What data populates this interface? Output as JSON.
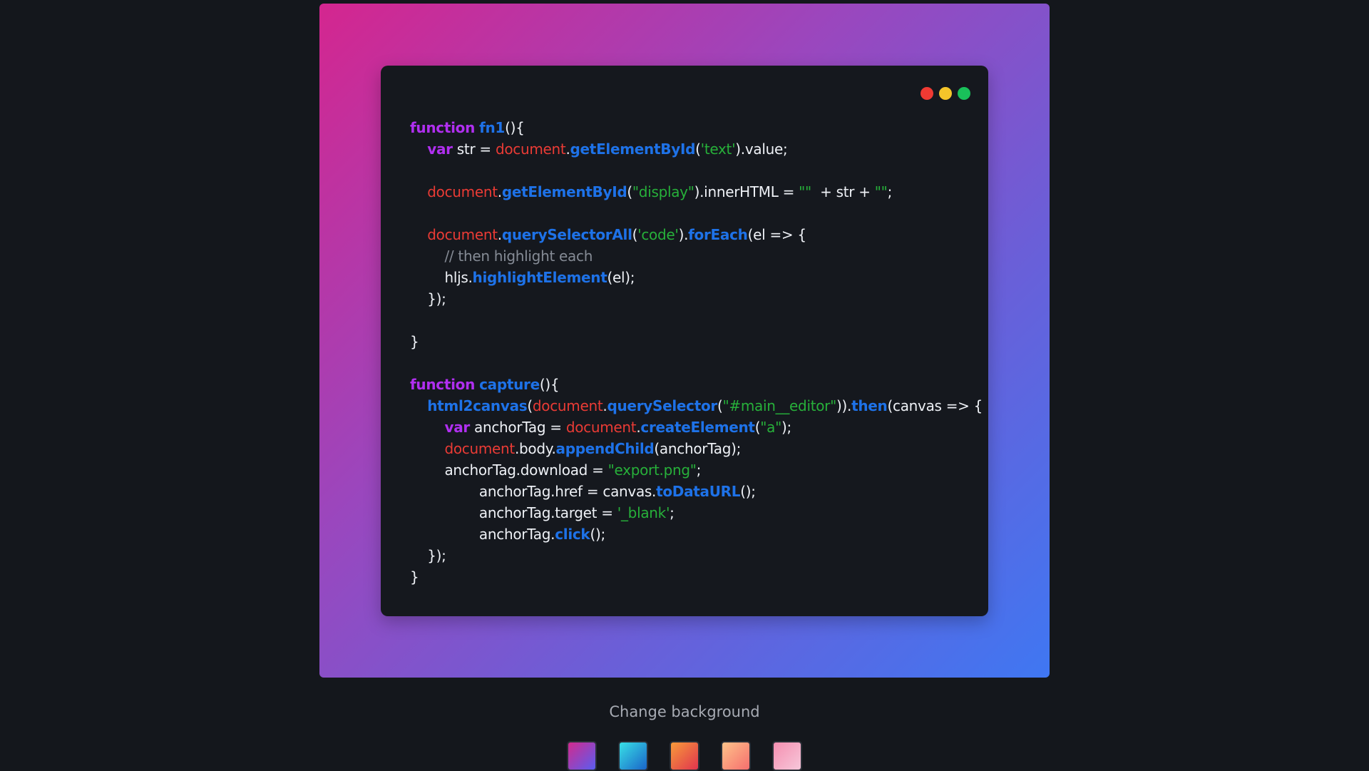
{
  "editor": {
    "window_dots": [
      {
        "name": "close",
        "color": "#f03a33"
      },
      {
        "name": "minimize",
        "color": "#f4c52a"
      },
      {
        "name": "maximize",
        "color": "#19c15a"
      }
    ],
    "code_lines": [
      [
        {
          "t": "function",
          "c": "kw"
        },
        {
          "t": " ",
          "c": "plain"
        },
        {
          "t": "fn1",
          "c": "fn"
        },
        {
          "t": "(){",
          "c": "plain"
        }
      ],
      [
        {
          "t": "    ",
          "c": "plain"
        },
        {
          "t": "var",
          "c": "kw"
        },
        {
          "t": " str = ",
          "c": "plain"
        },
        {
          "t": "document",
          "c": "obj"
        },
        {
          "t": ".",
          "c": "plain"
        },
        {
          "t": "getElementById",
          "c": "fn"
        },
        {
          "t": "(",
          "c": "plain"
        },
        {
          "t": "'text'",
          "c": "str"
        },
        {
          "t": ").value;",
          "c": "plain"
        }
      ],
      [],
      [
        {
          "t": "    ",
          "c": "plain"
        },
        {
          "t": "document",
          "c": "obj"
        },
        {
          "t": ".",
          "c": "plain"
        },
        {
          "t": "getElementById",
          "c": "fn"
        },
        {
          "t": "(",
          "c": "plain"
        },
        {
          "t": "\"display\"",
          "c": "str"
        },
        {
          "t": ").innerHTML = ",
          "c": "plain"
        },
        {
          "t": "\"\"",
          "c": "str"
        },
        {
          "t": "  + str + ",
          "c": "plain"
        },
        {
          "t": "\"\"",
          "c": "str"
        },
        {
          "t": ";",
          "c": "plain"
        }
      ],
      [],
      [
        {
          "t": "    ",
          "c": "plain"
        },
        {
          "t": "document",
          "c": "obj"
        },
        {
          "t": ".",
          "c": "plain"
        },
        {
          "t": "querySelectorAll",
          "c": "fn"
        },
        {
          "t": "(",
          "c": "plain"
        },
        {
          "t": "'code'",
          "c": "str"
        },
        {
          "t": ").",
          "c": "plain"
        },
        {
          "t": "forEach",
          "c": "fn"
        },
        {
          "t": "(el => {",
          "c": "plain"
        }
      ],
      [
        {
          "t": "        ",
          "c": "plain"
        },
        {
          "t": "// then highlight each",
          "c": "com"
        }
      ],
      [
        {
          "t": "        hljs.",
          "c": "plain"
        },
        {
          "t": "highlightElement",
          "c": "fn"
        },
        {
          "t": "(el);",
          "c": "plain"
        }
      ],
      [
        {
          "t": "    });",
          "c": "plain"
        }
      ],
      [],
      [
        {
          "t": "}",
          "c": "plain"
        }
      ],
      [],
      [
        {
          "t": "function",
          "c": "kw"
        },
        {
          "t": " ",
          "c": "plain"
        },
        {
          "t": "capture",
          "c": "fn"
        },
        {
          "t": "(){",
          "c": "plain"
        }
      ],
      [
        {
          "t": "    ",
          "c": "plain"
        },
        {
          "t": "html2canvas",
          "c": "fn"
        },
        {
          "t": "(",
          "c": "plain"
        },
        {
          "t": "document",
          "c": "obj"
        },
        {
          "t": ".",
          "c": "plain"
        },
        {
          "t": "querySelector",
          "c": "fn"
        },
        {
          "t": "(",
          "c": "plain"
        },
        {
          "t": "\"#main__editor\"",
          "c": "str"
        },
        {
          "t": ")).",
          "c": "plain"
        },
        {
          "t": "then",
          "c": "fn"
        },
        {
          "t": "(canvas => {",
          "c": "plain"
        }
      ],
      [
        {
          "t": "        ",
          "c": "plain"
        },
        {
          "t": "var",
          "c": "kw"
        },
        {
          "t": " anchorTag = ",
          "c": "plain"
        },
        {
          "t": "document",
          "c": "obj"
        },
        {
          "t": ".",
          "c": "plain"
        },
        {
          "t": "createElement",
          "c": "fn"
        },
        {
          "t": "(",
          "c": "plain"
        },
        {
          "t": "\"a\"",
          "c": "str"
        },
        {
          "t": ");",
          "c": "plain"
        }
      ],
      [
        {
          "t": "        ",
          "c": "plain"
        },
        {
          "t": "document",
          "c": "obj"
        },
        {
          "t": ".body.",
          "c": "plain"
        },
        {
          "t": "appendChild",
          "c": "fn"
        },
        {
          "t": "(anchorTag);",
          "c": "plain"
        }
      ],
      [
        {
          "t": "        anchorTag.download = ",
          "c": "plain"
        },
        {
          "t": "\"export.png\"",
          "c": "str"
        },
        {
          "t": ";",
          "c": "plain"
        }
      ],
      [
        {
          "t": "                anchorTag.href = canvas.",
          "c": "plain"
        },
        {
          "t": "toDataURL",
          "c": "fn"
        },
        {
          "t": "();",
          "c": "plain"
        }
      ],
      [
        {
          "t": "                anchorTag.target = ",
          "c": "plain"
        },
        {
          "t": "'_blank'",
          "c": "str"
        },
        {
          "t": ";",
          "c": "plain"
        }
      ],
      [
        {
          "t": "                anchorTag.",
          "c": "plain"
        },
        {
          "t": "click",
          "c": "fn"
        },
        {
          "t": "();",
          "c": "plain"
        }
      ],
      [
        {
          "t": "    });",
          "c": "plain"
        }
      ],
      [
        {
          "t": "}",
          "c": "plain"
        }
      ]
    ]
  },
  "background_picker": {
    "label": "Change background",
    "swatches": [
      {
        "name": "pink-blue",
        "from": "#d12a8e",
        "to": "#5a5df0"
      },
      {
        "name": "cyan-blue",
        "from": "#38e0e6",
        "to": "#1a64c8"
      },
      {
        "name": "orange-red",
        "from": "#f89a3a",
        "to": "#e0344e"
      },
      {
        "name": "peach",
        "from": "#ffc38a",
        "to": "#f56e6e"
      },
      {
        "name": "pink-lilac",
        "from": "#f58fb0",
        "to": "#f6c7da"
      }
    ]
  }
}
